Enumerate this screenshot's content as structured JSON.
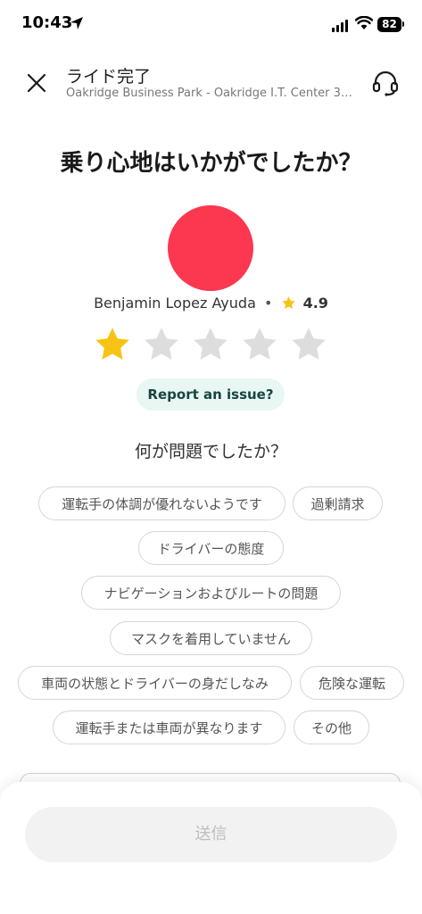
{
  "status_bar": {
    "time": "10:43",
    "battery": "82"
  },
  "header": {
    "title": "ライド完了",
    "subtitle": "Oakridge Business Park - Oakridge I.T. Center 3…"
  },
  "question": "乗り心地はいかがでしたか？",
  "driver": {
    "name": "Benjamin Lopez Ayuda",
    "separator": "•",
    "rating": "4.9",
    "avatar_color": "#fc3750"
  },
  "rating": {
    "selected": 1,
    "max": 5,
    "active_color": "#f7c314",
    "inactive_color": "#dddddd"
  },
  "report_issue_label": "Report an issue?",
  "issue_question": "何が問題でしたか？",
  "chips": [
    "運転手の体調が優れないようです",
    "過剰請求",
    "ドライバーの態度",
    "ナビゲーションおよびルートの問題",
    "マスクを着用していません",
    "車両の状態とドライバーの身だしなみ",
    "危険な運転",
    "運転手または車両が異なります",
    "その他"
  ],
  "submit_label": "送信",
  "icons": {
    "location": "location-arrow-icon",
    "signal": "cellular-signal-icon",
    "wifi": "wifi-icon",
    "close": "close-icon",
    "support": "headset-icon",
    "star": "star-icon"
  }
}
